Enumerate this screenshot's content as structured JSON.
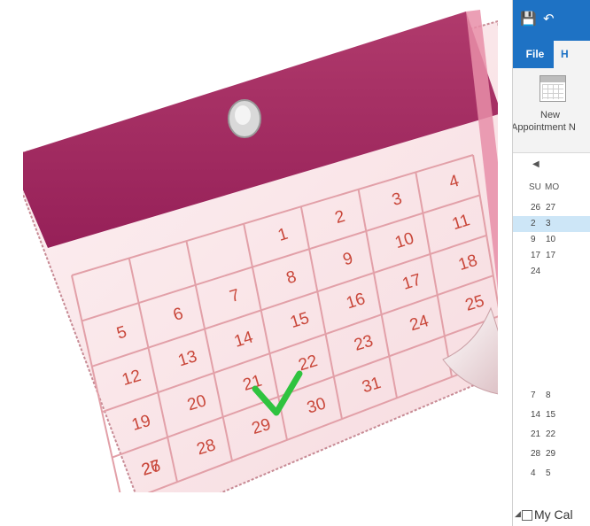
{
  "outlook": {
    "quick_access": {
      "save_icon": "save-icon",
      "undo_icon": "undo-icon"
    },
    "ribbon_tabs": [
      {
        "label": "File"
      },
      {
        "label": "H"
      }
    ],
    "ribbon": {
      "new_appointment": {
        "line1": "New",
        "line2": "Appointment N"
      }
    },
    "date_navigator": {
      "prev_icon": "chevron-left-icon",
      "days_of_week": [
        "SU",
        "MO"
      ],
      "weeks": [
        [
          "26",
          "27"
        ],
        [
          "2",
          "3"
        ],
        [
          "9",
          "10"
        ],
        [
          "17",
          "17"
        ],
        [
          "24",
          ""
        ]
      ],
      "selected_week_index": 1,
      "second_month_weeks": [
        [
          "7",
          "8"
        ],
        [
          "14",
          "15"
        ],
        [
          "21",
          "22"
        ],
        [
          "28",
          "29"
        ],
        [
          "4",
          "5"
        ]
      ]
    },
    "folder_pane": {
      "item": "My Cal"
    }
  },
  "clipart": {
    "days": [
      "1",
      "2",
      "3",
      "4",
      "5",
      "6",
      "7",
      "8",
      "9",
      "10",
      "11",
      "12",
      "13",
      "14",
      "15",
      "16",
      "17",
      "18",
      "19",
      "20",
      "21",
      "22",
      "23",
      "24",
      "25",
      "26",
      "27",
      "28",
      "29",
      "30",
      "31"
    ],
    "checked_day": "22",
    "colors": {
      "binding": "#a5285f",
      "page": "#fbe8ea",
      "grid": "#e6a6ad",
      "digits": "#c9473a",
      "check": "#2fc33f"
    }
  }
}
